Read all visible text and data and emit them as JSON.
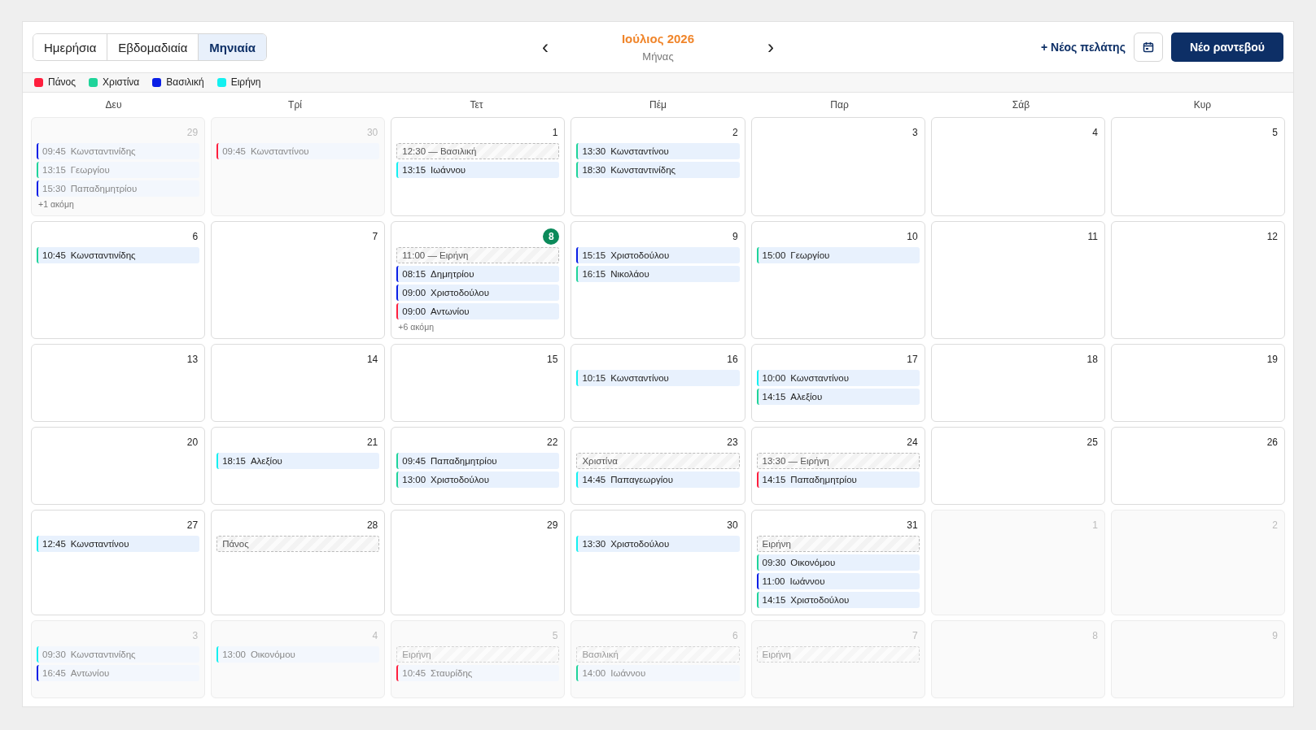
{
  "view_tabs": [
    {
      "label": "Ημερήσια",
      "selected": false
    },
    {
      "label": "Εβδομαδιαία",
      "selected": false
    },
    {
      "label": "Μηνιαία",
      "selected": true
    }
  ],
  "nav": {
    "prev": "‹",
    "next": "›",
    "title": "Ιούλιος 2026",
    "subtitle": "Μήνας"
  },
  "actions": {
    "new_client": "+ Νέος πελάτης",
    "new_appointment": "Νέο ραντεβού"
  },
  "legend": [
    {
      "name": "Πάνος",
      "color": "#ff1f3d"
    },
    {
      "name": "Χριστίνα",
      "color": "#1fd49a"
    },
    {
      "name": "Βασιλική",
      "color": "#0a1fe6"
    },
    {
      "name": "Ειρήνη",
      "color": "#14f0f0"
    }
  ],
  "weekdays": [
    "Δευ",
    "Τρί",
    "Τετ",
    "Πέμ",
    "Παρ",
    "Σάβ",
    "Κυρ"
  ],
  "weeks": [
    [
      {
        "day": "29",
        "outside": true,
        "today": false,
        "events": [
          {
            "kind": "appointment",
            "time": "09:45",
            "client": "Κωνσταντινίδης",
            "color": "#0a1fe6"
          },
          {
            "kind": "appointment",
            "time": "13:15",
            "client": "Γεωργίου",
            "color": "#1fd49a"
          },
          {
            "kind": "appointment",
            "time": "15:30",
            "client": "Παπαδημητρίου",
            "color": "#0a1fe6"
          }
        ],
        "more": "+1 ακόμη"
      },
      {
        "day": "30",
        "outside": true,
        "today": false,
        "events": [
          {
            "kind": "appointment",
            "time": "09:45",
            "client": "Κωνσταντίνου",
            "color": "#ff1f3d"
          }
        ]
      },
      {
        "day": "1",
        "outside": false,
        "today": false,
        "events": [
          {
            "kind": "block",
            "label": "12:30 — Βασιλική"
          },
          {
            "kind": "appointment",
            "time": "13:15",
            "client": "Ιωάννου",
            "color": "#14f0f0"
          }
        ]
      },
      {
        "day": "2",
        "outside": false,
        "today": false,
        "events": [
          {
            "kind": "appointment",
            "time": "13:30",
            "client": "Κωνσταντίνου",
            "color": "#1fd49a"
          },
          {
            "kind": "appointment",
            "time": "18:30",
            "client": "Κωνσταντινίδης",
            "color": "#1fd49a"
          }
        ]
      },
      {
        "day": "3",
        "outside": false,
        "today": false
      },
      {
        "day": "4",
        "outside": false,
        "today": false
      },
      {
        "day": "5",
        "outside": false,
        "today": false
      }
    ],
    [
      {
        "day": "6",
        "outside": false,
        "today": false,
        "events": [
          {
            "kind": "appointment",
            "time": "10:45",
            "client": "Κωνσταντινίδης",
            "color": "#1fd49a"
          }
        ]
      },
      {
        "day": "7",
        "outside": false,
        "today": false
      },
      {
        "day": "8",
        "outside": false,
        "today": true,
        "events": [
          {
            "kind": "block",
            "label": "11:00 — Ειρήνη"
          },
          {
            "kind": "appointment",
            "time": "08:15",
            "client": "Δημητρίου",
            "color": "#0a1fe6"
          },
          {
            "kind": "appointment",
            "time": "09:00",
            "client": "Χριστοδούλου",
            "color": "#0a1fe6"
          },
          {
            "kind": "appointment",
            "time": "09:00",
            "client": "Αντωνίου",
            "color": "#ff1f3d"
          }
        ],
        "more": "+6 ακόμη"
      },
      {
        "day": "9",
        "outside": false,
        "today": false,
        "events": [
          {
            "kind": "appointment",
            "time": "15:15",
            "client": "Χριστοδούλου",
            "color": "#0a1fe6"
          },
          {
            "kind": "appointment",
            "time": "16:15",
            "client": "Νικολάου",
            "color": "#1fd49a"
          }
        ]
      },
      {
        "day": "10",
        "outside": false,
        "today": false,
        "events": [
          {
            "kind": "appointment",
            "time": "15:00",
            "client": "Γεωργίου",
            "color": "#1fd49a"
          }
        ]
      },
      {
        "day": "11",
        "outside": false,
        "today": false
      },
      {
        "day": "12",
        "outside": false,
        "today": false
      }
    ],
    [
      {
        "day": "13",
        "outside": false,
        "today": false
      },
      {
        "day": "14",
        "outside": false,
        "today": false
      },
      {
        "day": "15",
        "outside": false,
        "today": false
      },
      {
        "day": "16",
        "outside": false,
        "today": false,
        "events": [
          {
            "kind": "appointment",
            "time": "10:15",
            "client": "Κωνσταντίνου",
            "color": "#14f0f0"
          }
        ]
      },
      {
        "day": "17",
        "outside": false,
        "today": false,
        "events": [
          {
            "kind": "appointment",
            "time": "10:00",
            "client": "Κωνσταντίνου",
            "color": "#14f0f0"
          },
          {
            "kind": "appointment",
            "time": "14:15",
            "client": "Αλεξίου",
            "color": "#1fd49a"
          }
        ]
      },
      {
        "day": "18",
        "outside": false,
        "today": false
      },
      {
        "day": "19",
        "outside": false,
        "today": false
      }
    ],
    [
      {
        "day": "20",
        "outside": false,
        "today": false
      },
      {
        "day": "21",
        "outside": false,
        "today": false,
        "events": [
          {
            "kind": "appointment",
            "time": "18:15",
            "client": "Αλεξίου",
            "color": "#14f0f0"
          }
        ]
      },
      {
        "day": "22",
        "outside": false,
        "today": false,
        "events": [
          {
            "kind": "appointment",
            "time": "09:45",
            "client": "Παπαδημητρίου",
            "color": "#1fd49a"
          },
          {
            "kind": "appointment",
            "time": "13:00",
            "client": "Χριστοδούλου",
            "color": "#1fd49a"
          }
        ]
      },
      {
        "day": "23",
        "outside": false,
        "today": false,
        "events": [
          {
            "kind": "block",
            "label": "Χριστίνα"
          },
          {
            "kind": "appointment",
            "time": "14:45",
            "client": "Παπαγεωργίου",
            "color": "#14f0f0"
          }
        ]
      },
      {
        "day": "24",
        "outside": false,
        "today": false,
        "events": [
          {
            "kind": "block",
            "label": "13:30 — Ειρήνη"
          },
          {
            "kind": "appointment",
            "time": "14:15",
            "client": "Παπαδημητρίου",
            "color": "#ff1f3d"
          }
        ]
      },
      {
        "day": "25",
        "outside": false,
        "today": false
      },
      {
        "day": "26",
        "outside": false,
        "today": false
      }
    ],
    [
      {
        "day": "27",
        "outside": false,
        "today": false,
        "events": [
          {
            "kind": "appointment",
            "time": "12:45",
            "client": "Κωνσταντίνου",
            "color": "#14f0f0"
          }
        ]
      },
      {
        "day": "28",
        "outside": false,
        "today": false,
        "events": [
          {
            "kind": "block",
            "label": "Πάνος"
          }
        ]
      },
      {
        "day": "29",
        "outside": false,
        "today": false
      },
      {
        "day": "30",
        "outside": false,
        "today": false,
        "events": [
          {
            "kind": "appointment",
            "time": "13:30",
            "client": "Χριστοδούλου",
            "color": "#14f0f0"
          }
        ]
      },
      {
        "day": "31",
        "outside": false,
        "today": false,
        "events": [
          {
            "kind": "block",
            "label": "Ειρήνη"
          },
          {
            "kind": "appointment",
            "time": "09:30",
            "client": "Οικονόμου",
            "color": "#1fd49a"
          },
          {
            "kind": "appointment",
            "time": "11:00",
            "client": "Ιωάννου",
            "color": "#0a1fe6"
          },
          {
            "kind": "appointment",
            "time": "14:15",
            "client": "Χριστοδούλου",
            "color": "#1fd49a"
          }
        ]
      },
      {
        "day": "1",
        "outside": true,
        "today": false
      },
      {
        "day": "2",
        "outside": true,
        "today": false
      }
    ],
    [
      {
        "day": "3",
        "outside": true,
        "today": false,
        "events": [
          {
            "kind": "appointment",
            "time": "09:30",
            "client": "Κωνσταντινίδης",
            "color": "#14f0f0"
          },
          {
            "kind": "appointment",
            "time": "16:45",
            "client": "Αντωνίου",
            "color": "#0a1fe6"
          }
        ]
      },
      {
        "day": "4",
        "outside": true,
        "today": false,
        "events": [
          {
            "kind": "appointment",
            "time": "13:00",
            "client": "Οικονόμου",
            "color": "#14f0f0"
          }
        ]
      },
      {
        "day": "5",
        "outside": true,
        "today": false,
        "events": [
          {
            "kind": "block",
            "label": "Ειρήνη"
          },
          {
            "kind": "appointment",
            "time": "10:45",
            "client": "Σταυρίδης",
            "color": "#ff1f3d"
          }
        ]
      },
      {
        "day": "6",
        "outside": true,
        "today": false,
        "events": [
          {
            "kind": "block",
            "label": "Βασιλική"
          },
          {
            "kind": "appointment",
            "time": "14:00",
            "client": "Ιωάννου",
            "color": "#1fd49a"
          }
        ]
      },
      {
        "day": "7",
        "outside": true,
        "today": false,
        "events": [
          {
            "kind": "block",
            "label": "Ειρήνη"
          }
        ]
      },
      {
        "day": "8",
        "outside": true,
        "today": false
      },
      {
        "day": "9",
        "outside": true,
        "today": false
      }
    ]
  ]
}
